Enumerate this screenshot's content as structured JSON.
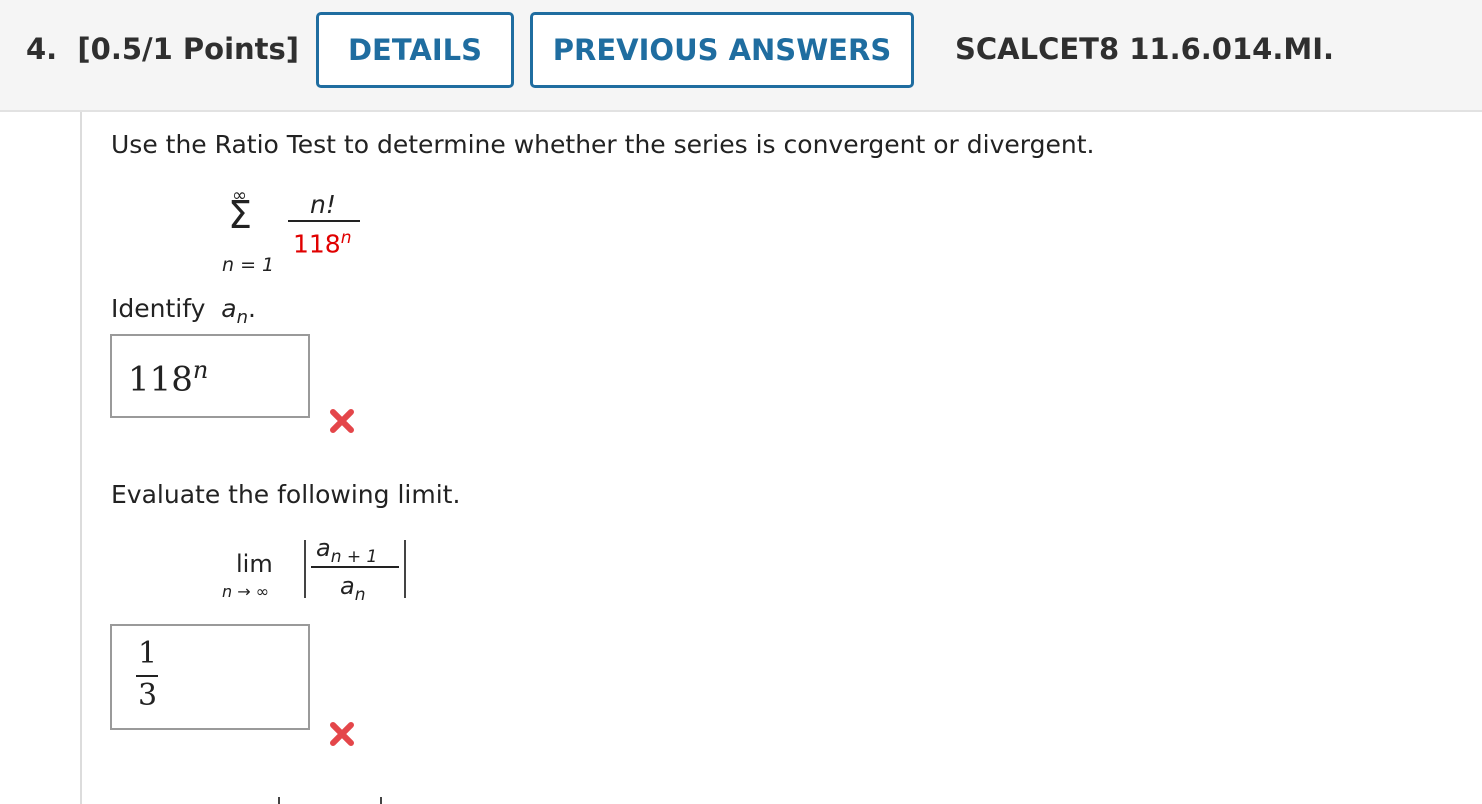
{
  "header": {
    "question_number": "4.",
    "points": "[0.5/1 Points]",
    "details_label": "DETAILS",
    "previous_answers_label": "PREVIOUS ANSWERS",
    "question_id": "SCALCET8 11.6.014.MI."
  },
  "prompt": "Use the Ratio Test to determine whether the series is convergent or divergent.",
  "series": {
    "sum_upper": "∞",
    "sum_symbol": "Σ",
    "sum_lower": "n = 1",
    "numerator": "n!",
    "denominator_base": "118",
    "denominator_exp": "n"
  },
  "part1": {
    "label_prefix": "Identify",
    "label_var": "a",
    "label_sub": "n",
    "label_suffix": ".",
    "answer_base": "118",
    "answer_exp": "n",
    "status_icon": "incorrect-x-icon"
  },
  "part2": {
    "label": "Evaluate the following limit.",
    "lim_word": "lim",
    "lim_sub": "n → ∞",
    "num_var": "a",
    "num_sub": "n + 1",
    "den_var": "a",
    "den_sub": "n",
    "answer_num": "1",
    "answer_den": "3",
    "status_icon": "incorrect-x-icon"
  },
  "colors": {
    "accent": "#1f6da0",
    "incorrect": "#e4464a",
    "highlight": "#e00000"
  }
}
